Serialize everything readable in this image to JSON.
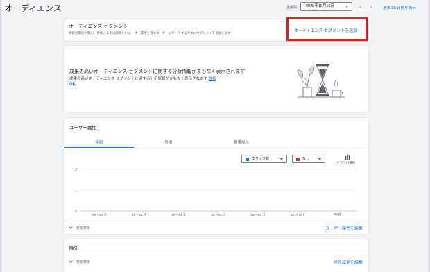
{
  "header": {
    "title": "オーディエンス",
    "date_label": "全期間",
    "date_value": "2025年10月16日",
    "past_link": "過去 30 日間を表示"
  },
  "segment_card": {
    "title": "オーディエンス セグメント",
    "description": "特定の興味や関心、行動、または説明しいユーザー属性を持つユーザーにリーチするためにセグメントを追加します",
    "add_link": "オーディエンス セグメントを追加"
  },
  "insight_card": {
    "title": "成果の高いオーディエンス セグメントに関する分析情報がまもなく表示されます",
    "description": "成果の高いオーディエンス セグメントに関する分析情報がまもなく表示されます",
    "more_link": "詳細",
    "ok_label": "OK"
  },
  "demographics_card": {
    "title": "ユーザー属性",
    "tabs": [
      {
        "label": "年齢"
      },
      {
        "label": "性別"
      },
      {
        "label": "世帯収入"
      }
    ],
    "metric_dropdown": "クリック数",
    "compare_dropdown": "なし",
    "chart_type_label": "グラフの種類",
    "show_table": "表を表示",
    "edit_link": "ユーザー属性を編集"
  },
  "exclusion_card": {
    "title": "除外",
    "show_table": "表を表示",
    "edit_link": "除外設定を編集"
  },
  "colors": {
    "accent": "#1a73e8",
    "highlight": "#e02020",
    "metric_swatch": "#1a73e8",
    "compare_swatch": "#d93025"
  },
  "chart_data": {
    "type": "bar",
    "categories": [
      "18〜24 才",
      "25〜34 才",
      "35〜44 才",
      "45〜54 才",
      "55〜64 才",
      "65 才以上",
      "不明"
    ],
    "series": [
      {
        "values": [
          0,
          0,
          0,
          0,
          0,
          0,
          0
        ]
      }
    ],
    "y_ticks": [
      "0",
      "1",
      "2"
    ],
    "ylim": [
      0,
      2
    ],
    "grid": true
  }
}
